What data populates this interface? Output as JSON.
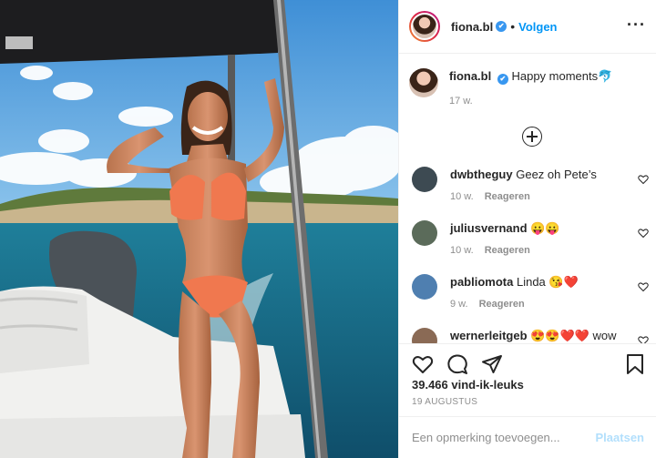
{
  "post": {
    "username": "fiona.bl",
    "verified": true,
    "follow_label": "Volgen",
    "separator": "•",
    "more_label": "···",
    "caption_text": "Happy moments",
    "caption_emoji": "🐬",
    "caption_age": "17 w.",
    "likes": "39.466 vind-ik-leuks",
    "date": "19 AUGUSTUS"
  },
  "comments": [
    {
      "username": "dwbtheguy",
      "text": "Geez oh Pete’s",
      "age": "10 w.",
      "reply_label": "Reageren",
      "avatar_color": "#3d4a52"
    },
    {
      "username": "juliusvernand",
      "text": "😛😛",
      "age": "10 w.",
      "reply_label": "Reageren",
      "avatar_color": "#5b6b5a"
    },
    {
      "username": "pabliomota",
      "text": "Linda 😘❤️",
      "age": "9 w.",
      "reply_label": "Reageren",
      "avatar_color": "#4f7fb0"
    },
    {
      "username": "wernerleitgeb",
      "text": "😍😍❤️❤️ wow",
      "age": "",
      "reply_label": "",
      "avatar_color": "#8a6a55"
    }
  ],
  "add_comment": {
    "placeholder": "Een opmerking toevoegen...",
    "post_label": "Plaatsen"
  },
  "icons": {
    "like": "heart-icon",
    "comment": "comment-icon",
    "share": "share-icon",
    "save": "bookmark-icon",
    "expand": "plus-circle-icon"
  },
  "colors": {
    "accent": "#0095f6",
    "verified": "#3897f0",
    "muted": "#8e8e8e",
    "post_disabled": "#b2dffc"
  }
}
